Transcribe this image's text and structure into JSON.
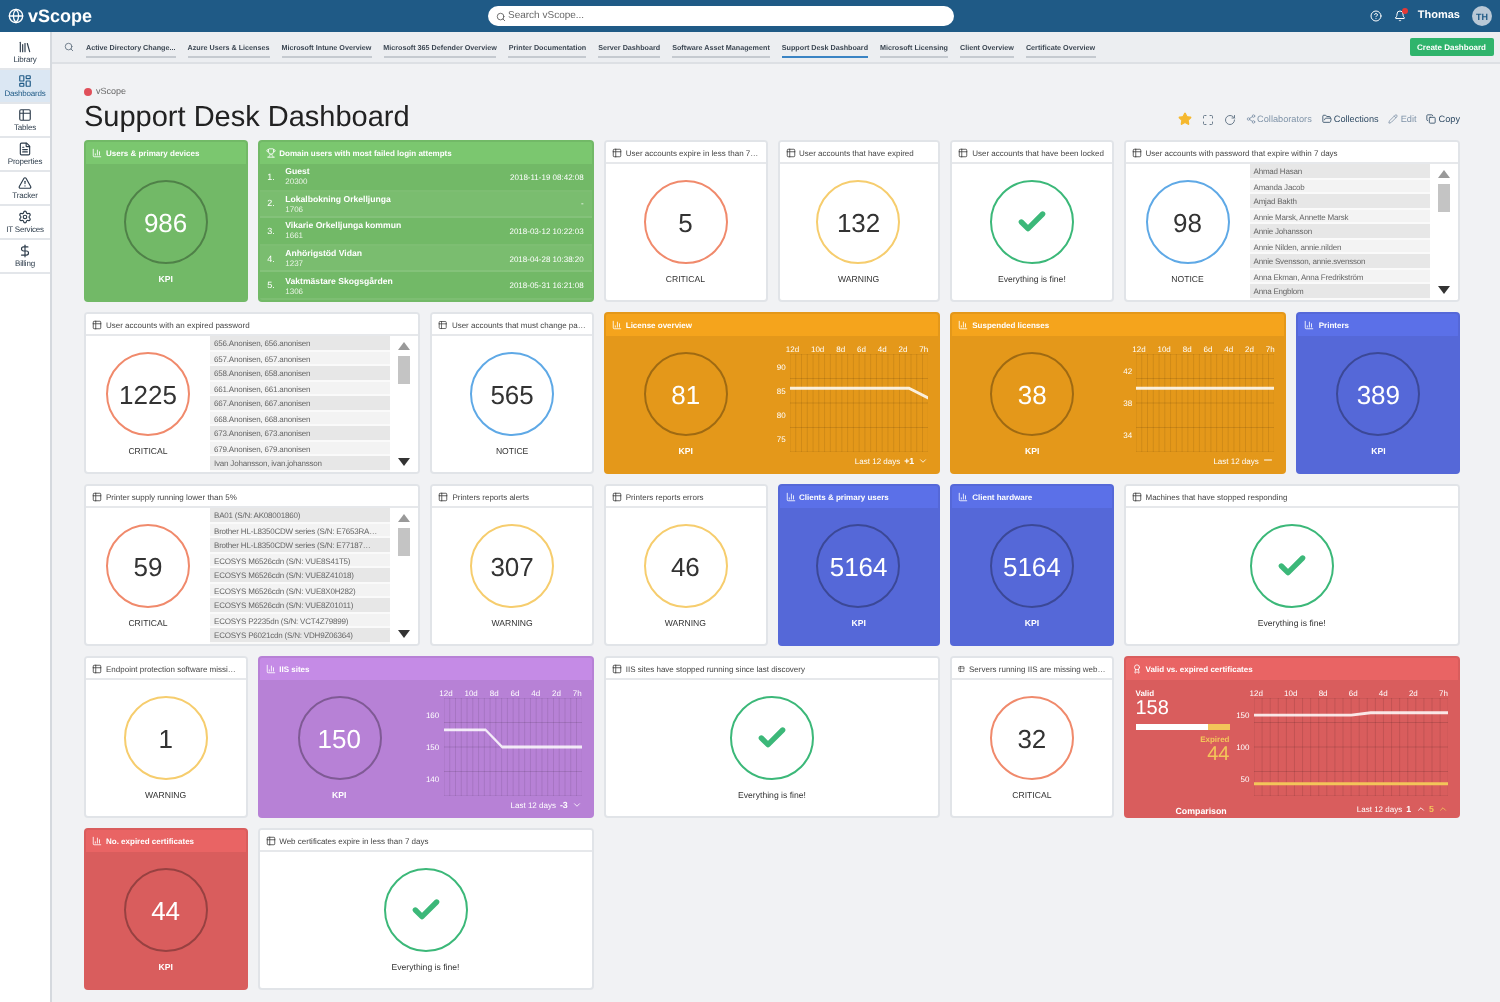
{
  "topbar": {
    "brand": "vScope",
    "search": {
      "placeholder": "Search vScope..."
    },
    "notifications": {
      "unread": true
    },
    "user": {
      "name": "Thomas",
      "initials": "TH"
    }
  },
  "sidebar": {
    "items": [
      {
        "label": "Library",
        "selected": false
      },
      {
        "label": "Dashboards",
        "selected": true
      },
      {
        "label": "Tables",
        "selected": false
      },
      {
        "label": "Properties",
        "selected": false
      },
      {
        "label": "Tracker",
        "selected": false
      },
      {
        "label": "IT Services",
        "selected": false
      },
      {
        "label": "Billing",
        "selected": false
      }
    ]
  },
  "tabs": [
    {
      "label": "Active Directory Change...",
      "selected": false
    },
    {
      "label": "Azure Users & Licenses",
      "selected": false
    },
    {
      "label": "Microsoft Intune Overview",
      "selected": false
    },
    {
      "label": "Microsoft 365 Defender Overview",
      "selected": false
    },
    {
      "label": "Printer Documentation",
      "selected": false
    },
    {
      "label": "Server Dashboard",
      "selected": false
    },
    {
      "label": "Software Asset Management",
      "selected": false
    },
    {
      "label": "Support Desk Dashboard",
      "selected": true
    },
    {
      "label": "Microsoft Licensing",
      "selected": false
    },
    {
      "label": "Client Overview",
      "selected": false
    },
    {
      "label": "Certificate Overview",
      "selected": false
    }
  ],
  "create_button": "Create Dashboard",
  "header": {
    "breadcrumb": "vScope",
    "title": "Support Desk Dashboard",
    "starred": true,
    "actions": [
      {
        "label": "Collaborators",
        "disabled": true
      },
      {
        "label": "Collections",
        "disabled": false
      },
      {
        "label": "Edit",
        "disabled": true
      },
      {
        "label": "Copy",
        "disabled": false
      }
    ]
  },
  "tiles": [
    {
      "kind": "kpi",
      "title": "Users & primary devices",
      "color": "#7bc76f",
      "value": "986",
      "label": "KPI"
    },
    {
      "kind": "ranking",
      "title": "Domain users with most failed login attempts",
      "color": "#7bc76f",
      "rows": [
        {
          "rank": "1.",
          "name": "Guest",
          "id": "20300",
          "time": "2018-11-19 08:42:08"
        },
        {
          "rank": "2.",
          "name": "Lokalbokning Orkelljunga",
          "id": "1706",
          "time": "-"
        },
        {
          "rank": "3.",
          "name": "Vikarie Orkelljunga kommun",
          "id": "1661",
          "time": "2018-03-12 10:22:03"
        },
        {
          "rank": "4.",
          "name": "Anhörigstöd Vidan",
          "id": "1237",
          "time": "2018-04-28 10:38:20"
        },
        {
          "rank": "5.",
          "name": "Vaktmästare Skogsgården",
          "id": "1306",
          "time": "2018-05-31 16:21:08"
        }
      ]
    },
    {
      "kind": "gauge",
      "title": "User accounts expire in less than 7…",
      "color": "#f08a6c",
      "value": "5",
      "label": "CRITICAL"
    },
    {
      "kind": "gauge",
      "title": "User accounts that have expired",
      "color": "#f6cd6e",
      "value": "132",
      "label": "WARNING"
    },
    {
      "kind": "ok",
      "title": "User accounts that have been locked",
      "label": "Everything is fine!"
    },
    {
      "kind": "gauge",
      "title": "User accounts with password that expire within 7 days",
      "color": "#5fa9e6",
      "value": "98",
      "label": "NOTICE",
      "list": [
        "Ahmad Hasan",
        "Amanda Jacob",
        "Amjad Bakth",
        "Annie Marsk, Annette Marsk",
        "Annie Johansson",
        "Annie Nilden, annie.nilden",
        "Annie Svensson, annie.svensson",
        "Anna Ekman, Anna Fredrikström",
        "Anna Engblom"
      ]
    },
    {
      "kind": "gauge",
      "title": "User accounts with an expired password",
      "color": "#f08a6c",
      "value": "1225",
      "label": "CRITICAL",
      "list": [
        "656.Anonisen, 656.anonisen",
        "657.Anonisen, 657.anonisen",
        "658.Anonisen, 658.anonisen",
        "661.Anonisen, 661.anonisen",
        "667.Anonisen, 667.anonisen",
        "668.Anonisen, 668.anonisen",
        "673.Anonisen, 673.anonisen",
        "679.Anonisen, 679.anonisen",
        "Ivan Johansson, ivan.johansson"
      ]
    },
    {
      "kind": "gauge",
      "title": "User accounts that must change pa…",
      "color": "#5fa9e6",
      "value": "565",
      "label": "NOTICE"
    },
    {
      "kind": "trend",
      "title": "License overview",
      "color": "#f5a41c",
      "value": "81",
      "label": "KPI",
      "chart": {
        "x_labels": [
          "12d",
          "10d",
          "8d",
          "6d",
          "4d",
          "2d",
          "7h"
        ],
        "y_labels": [
          "90",
          "85",
          "80",
          "75"
        ]
      },
      "footer": {
        "period": "Last 12 days",
        "deltas": [
          {
            "text": "+1",
            "kind": "down"
          }
        ]
      }
    },
    {
      "kind": "trend",
      "title": "Suspended licenses",
      "color": "#f5a41c",
      "value": "38",
      "label": "KPI",
      "chart": {
        "x_labels": [
          "12d",
          "10d",
          "8d",
          "6d",
          "4d",
          "2d",
          "7h"
        ],
        "y_labels": [
          "42",
          "38",
          "34"
        ]
      },
      "footer": {
        "period": "Last 12 days",
        "deltas": [
          {
            "kind": "flat"
          }
        ]
      }
    },
    {
      "kind": "kpi",
      "title": "Printers",
      "color": "#5b70e8",
      "value": "389",
      "label": "KPI"
    },
    {
      "kind": "gauge",
      "title": "Printer supply running lower than 5%",
      "color": "#f08a6c",
      "value": "59",
      "label": "CRITICAL",
      "list": [
        "BA01 (S/N: AK08001860)",
        "Brother HL-L8350CDW series (S/N: E7653RA…",
        "Brother HL-L8350CDW series (S/N: E77187…",
        "ECOSYS M6526cdn (S/N: VUE8S41T5)",
        "ECOSYS M6526cdn (S/N: VUE8Z41018)",
        "ECOSYS M6526cdn (S/N: VUE8X0H282)",
        "ECOSYS M6526cdn (S/N: VUE8Z01011)",
        "ECOSYS P2235dn (S/N: VCT4Z79899)",
        "ECOSYS P6021cdn (S/N: VDH9Z06364)"
      ]
    },
    {
      "kind": "gauge",
      "title": "Printers reports alerts",
      "color": "#f6cd6e",
      "value": "307",
      "label": "WARNING"
    },
    {
      "kind": "gauge",
      "title": "Printers reports errors",
      "color": "#f6cd6e",
      "value": "46",
      "label": "WARNING"
    },
    {
      "kind": "kpi",
      "title": "Clients & primary users",
      "color": "#5b70e8",
      "value": "5164",
      "label": "KPI"
    },
    {
      "kind": "kpi",
      "title": "Client hardware",
      "color": "#5b70e8",
      "value": "5164",
      "label": "KPI"
    },
    {
      "kind": "ok",
      "title": "Machines that have stopped responding",
      "label": "Everything is fine!"
    },
    {
      "kind": "gauge",
      "title": "Endpoint protection software missi…",
      "color": "#f6cd6e",
      "value": "1",
      "label": "WARNING"
    },
    {
      "kind": "trend",
      "title": "IIS sites",
      "color": "#c58be6",
      "value": "150",
      "label": "KPI",
      "chart": {
        "x_labels": [
          "12d",
          "10d",
          "8d",
          "6d",
          "4d",
          "2d",
          "7h"
        ],
        "y_labels": [
          "160",
          "150",
          "140"
        ]
      },
      "footer": {
        "period": "Last 12 days",
        "deltas": [
          {
            "text": "-3",
            "kind": "down"
          }
        ]
      }
    },
    {
      "kind": "ok",
      "title": "IIS sites have stopped running since last discovery",
      "label": "Everything is fine!"
    },
    {
      "kind": "gauge",
      "title": "Servers running IIS are missing web…",
      "color": "#f08a6c",
      "value": "32",
      "label": "CRITICAL"
    },
    {
      "kind": "comparison",
      "title": "Valid vs. expired certificates",
      "color": "#e96464",
      "first": {
        "label": "Valid",
        "value": "158"
      },
      "second": {
        "label": "Expired",
        "value": "44"
      },
      "level": 0.78,
      "label": "Comparison",
      "chart": {
        "x_labels": [
          "12d",
          "10d",
          "8d",
          "6d",
          "4d",
          "2d",
          "7h"
        ],
        "y_labels": [
          "150",
          "100",
          "50"
        ]
      },
      "footer": {
        "period": "Last 12 days",
        "deltas": [
          {
            "text": "1",
            "kind": "up"
          },
          {
            "text": "5",
            "kind": "up"
          }
        ]
      }
    },
    {
      "kind": "kpi",
      "title": "No. expired certificates",
      "color": "#e96464",
      "value": "44",
      "label": "KPI"
    },
    {
      "kind": "ok",
      "title": "Web certificates expire in less than 7 days",
      "label": "Everything is fine!"
    }
  ]
}
